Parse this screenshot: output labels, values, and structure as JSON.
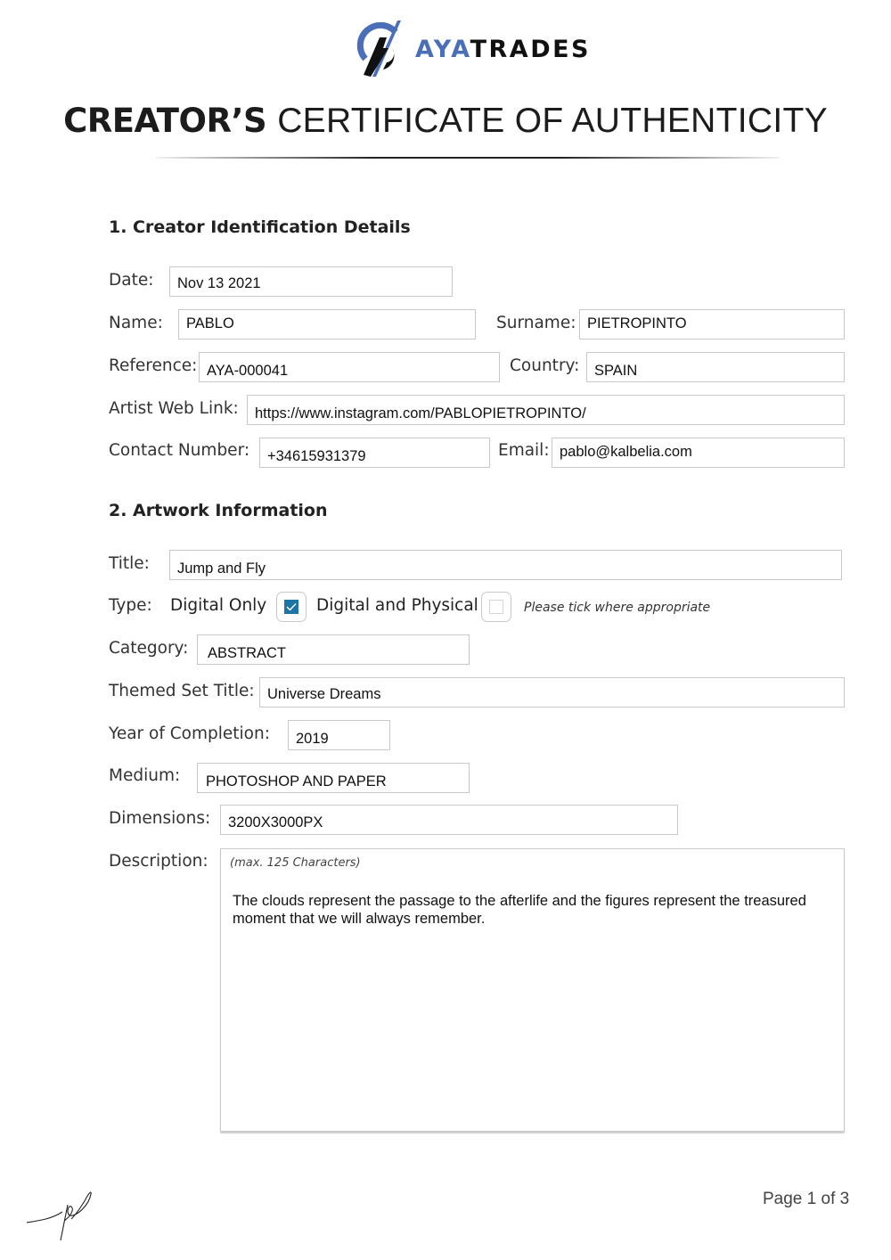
{
  "header": {
    "brand_highlight": "AYA",
    "brand_rest": "TRADES",
    "brand_color": "#4a6fb8",
    "logo_icon": "ayatrades-logo-icon",
    "title_bold": "CREATOR’S",
    "title_light": "CERTIFICATE OF AUTHENTICITY"
  },
  "section1": {
    "heading": "1. Creator Identification Details",
    "fields": {
      "date": {
        "label": "Date:",
        "value": "Nov 13 2021"
      },
      "name": {
        "label": "Name:",
        "value": "PABLO"
      },
      "surname": {
        "label": "Surname:",
        "value": "PIETROPINTO"
      },
      "reference": {
        "label": "Reference:",
        "value": "AYA-000041"
      },
      "country": {
        "label": "Country:",
        "value": "SPAIN"
      },
      "web_link": {
        "label": "Artist Web Link:",
        "value": "https://www.instagram.com/PABLOPIETROPINTO/"
      },
      "contact_number": {
        "label": "Contact Number:",
        "value": "+34615931379"
      },
      "email": {
        "label": "Email:",
        "value": "pablo@kalbelia.com"
      }
    }
  },
  "section2": {
    "heading": "2. Artwork Information",
    "fields": {
      "title": {
        "label": "Title:",
        "value": "Jump and Fly"
      },
      "type": {
        "label": "Type:",
        "options": [
          {
            "label": "Digital Only",
            "checked": true
          },
          {
            "label": "Digital and Physical",
            "checked": false
          }
        ],
        "hint": "Please tick where appropriate",
        "check_color": "#1f74a6"
      },
      "category": {
        "label": "Category:",
        "value": "ABSTRACT"
      },
      "themed_set_title": {
        "label": "Themed Set Title:",
        "value": "Universe Dreams"
      },
      "year_of_completion": {
        "label": "Year of Completion:",
        "value": "2019"
      },
      "medium": {
        "label": "Medium:",
        "value": "PHOTOSHOP AND PAPER"
      },
      "dimensions": {
        "label": "Dimensions:",
        "value": "3200X3000PX"
      },
      "description": {
        "label": "Description:",
        "hint": "(max. 125 Characters)",
        "value": "The clouds represent the passage to the afterlife and the figures represent the treasured moment that we will always remember."
      }
    }
  },
  "footer": {
    "signature_icon": "signature-icon",
    "page_label": "Page 1 of 3"
  }
}
